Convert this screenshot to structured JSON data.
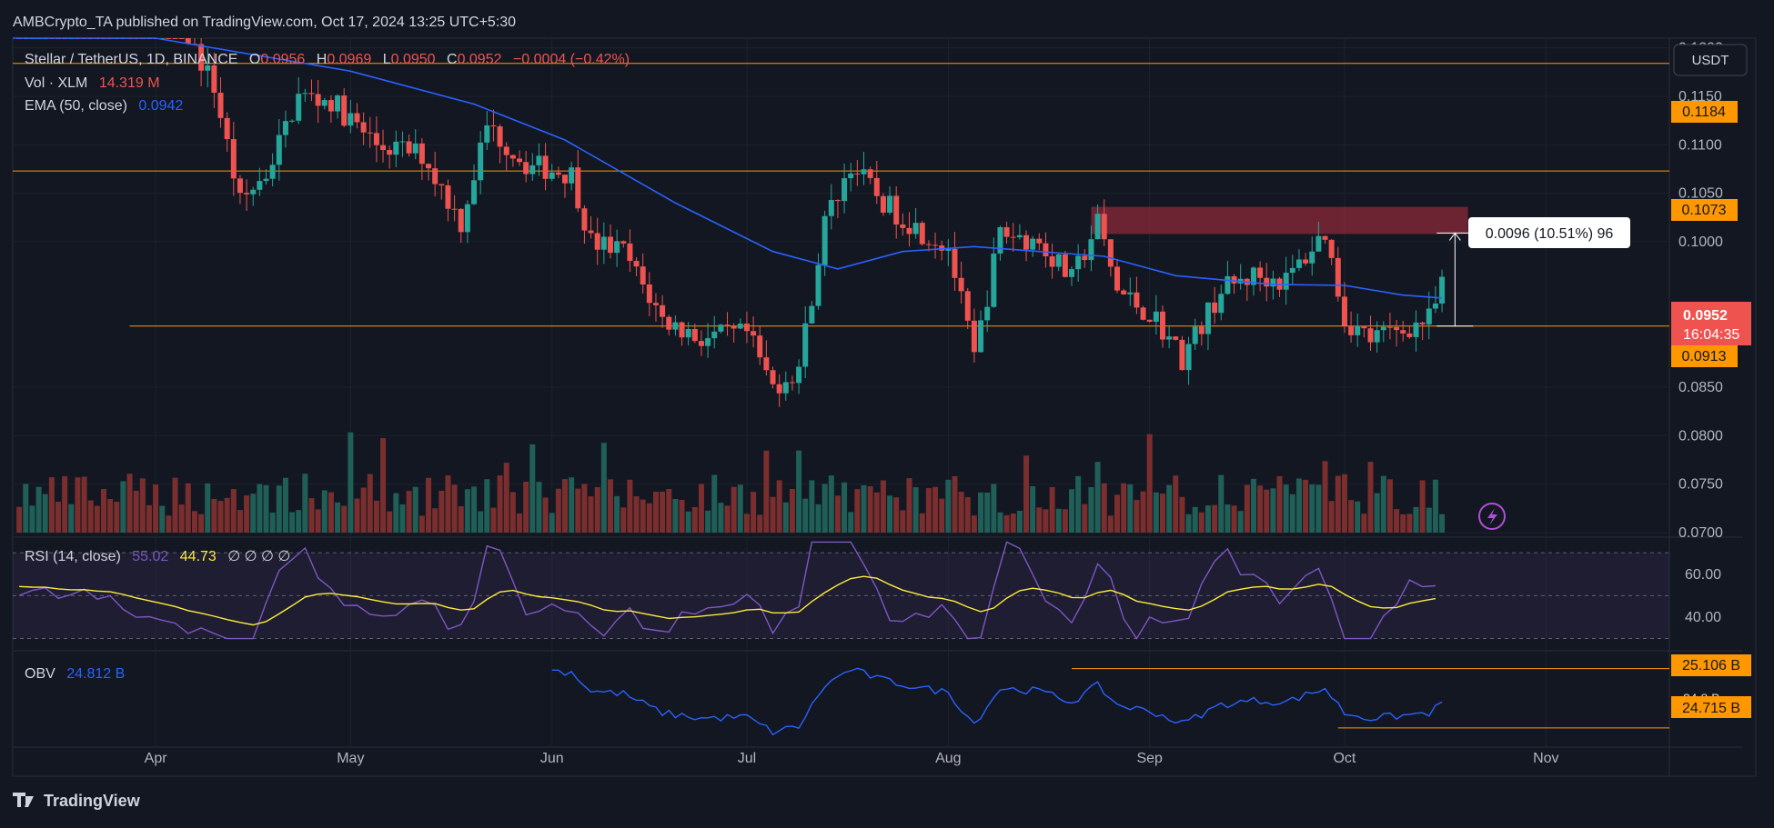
{
  "header": {
    "published_text": "AMBCrypto_TA published on TradingView.com, Oct 17, 2024 13:25 UTC+5:30",
    "currency_button": "USDT"
  },
  "legend": {
    "symbol": "Stellar / TetherUS, 1D, BINANCE",
    "o_label": "O",
    "o_value": "0.0956",
    "h_label": "H",
    "h_value": "0.0969",
    "l_label": "L",
    "l_value": "0.0950",
    "c_label": "C",
    "c_value": "0.0952",
    "change": "−0.0004 (−0.42%)",
    "vol_label": "Vol · XLM",
    "vol_value": "14.319 M",
    "ema_label": "EMA (50, close)",
    "ema_value": "0.0942",
    "rsi_label": "RSI (14, close)",
    "rsi_value": "55.02",
    "rsi_ma_value": "44.73",
    "rsi_extra": "∅ ∅ ∅ ∅",
    "obv_label": "OBV",
    "obv_value": "24.812 B"
  },
  "measure": {
    "label": "0.0096 (10.51%) 96"
  },
  "badges": {
    "r1": "0.1184",
    "r2": "0.1073",
    "s1": "0.0913",
    "last_price": "0.0952",
    "countdown": "16:04:35",
    "obv_hi": "25.106 B",
    "obv_lo": "24.715 B",
    "obv_cur": "24.8 B"
  },
  "footer": {
    "brand": "TradingView"
  },
  "colors": {
    "background": "#131722",
    "up": "#26a69a",
    "down": "#ef5350",
    "hline": "#ff9800",
    "ema": "#2962ff",
    "rsi": "#7e57c2",
    "rsi_ma": "#ffeb3b",
    "obv": "#2962ff",
    "zone": "#8b2a3a"
  },
  "chart_data": {
    "type": "candlestick",
    "timeframe": "1D",
    "x_range": [
      "2024-03-10",
      "2024-11-20"
    ],
    "x_ticks": [
      "Apr",
      "May",
      "Jun",
      "Jul",
      "Aug",
      "Sep",
      "Oct",
      "Nov"
    ],
    "y_ticks": [
      "0.1200",
      "0.1150",
      "0.1100",
      "0.1050",
      "0.1000",
      "0.0850",
      "0.0800",
      "0.0750",
      "0.0700"
    ],
    "y_range": [
      0.07,
      0.121
    ],
    "horizontal_levels": [
      0.1184,
      0.1073,
      0.0913
    ],
    "resistance_zone": {
      "from_date": "2024-08-23",
      "to_date": "2024-10-20",
      "low": 0.1008,
      "high": 0.1036
    },
    "measurement": {
      "date": "2024-10-18",
      "from": 0.0913,
      "to": 0.1009
    },
    "ema_path": [
      [
        "2024-03-10",
        0.1232
      ],
      [
        "2024-04-01",
        0.1215
      ],
      [
        "2024-05-01",
        0.1176
      ],
      [
        "2024-05-20",
        0.1142
      ],
      [
        "2024-06-03",
        0.1105
      ],
      [
        "2024-06-20",
        0.104
      ],
      [
        "2024-07-05",
        0.099
      ],
      [
        "2024-07-15",
        0.0972
      ],
      [
        "2024-07-25",
        0.099
      ],
      [
        "2024-08-05",
        0.0995
      ],
      [
        "2024-08-15",
        0.099
      ],
      [
        "2024-08-25",
        0.0985
      ],
      [
        "2024-09-05",
        0.0965
      ],
      [
        "2024-09-20",
        0.0956
      ],
      [
        "2024-10-01",
        0.0955
      ],
      [
        "2024-10-10",
        0.0945
      ],
      [
        "2024-10-16",
        0.0942
      ]
    ],
    "close_path": [
      [
        "2024-03-22",
        0.135
      ],
      [
        "2024-04-03",
        0.125
      ],
      [
        "2024-04-10",
        0.116
      ],
      [
        "2024-04-14",
        0.104
      ],
      [
        "2024-04-18",
        0.107
      ],
      [
        "2024-04-23",
        0.115
      ],
      [
        "2024-04-28",
        0.1145
      ],
      [
        "2024-05-05",
        0.11
      ],
      [
        "2024-05-12",
        0.109
      ],
      [
        "2024-05-18",
        0.102
      ],
      [
        "2024-05-22",
        0.112
      ],
      [
        "2024-05-28",
        0.108
      ],
      [
        "2024-06-04",
        0.107
      ],
      [
        "2024-06-07",
        0.1
      ],
      [
        "2024-06-12",
        0.099
      ],
      [
        "2024-06-18",
        0.092
      ],
      [
        "2024-06-24",
        0.09
      ],
      [
        "2024-07-01",
        0.0905
      ],
      [
        "2024-07-05",
        0.085
      ],
      [
        "2024-07-09",
        0.087
      ],
      [
        "2024-07-13",
        0.102
      ],
      [
        "2024-07-17",
        0.108
      ],
      [
        "2024-07-22",
        0.104
      ],
      [
        "2024-07-28",
        0.101
      ],
      [
        "2024-08-01",
        0.0995
      ],
      [
        "2024-08-05",
        0.088
      ],
      [
        "2024-08-09",
        0.101
      ],
      [
        "2024-08-15",
        0.1
      ],
      [
        "2024-08-20",
        0.096
      ],
      [
        "2024-08-24",
        0.102
      ],
      [
        "2024-08-27",
        0.095
      ],
      [
        "2024-09-02",
        0.092
      ],
      [
        "2024-09-06",
        0.088
      ],
      [
        "2024-09-12",
        0.095
      ],
      [
        "2024-09-17",
        0.0965
      ],
      [
        "2024-09-22",
        0.096
      ],
      [
        "2024-09-28",
        0.101
      ],
      [
        "2024-10-01",
        0.092
      ],
      [
        "2024-10-05",
        0.09
      ],
      [
        "2024-10-10",
        0.091
      ],
      [
        "2024-10-14",
        0.092
      ],
      [
        "2024-10-16",
        0.0952
      ]
    ],
    "volume_y_range": [
      0,
      14
    ],
    "rsi": {
      "y_ticks": [
        "60.00",
        "40.00"
      ],
      "levels": [
        70,
        50,
        30
      ],
      "y_range": [
        26,
        76
      ]
    },
    "obv": {
      "levels": [
        25.106,
        24.715
      ],
      "y_range": [
        24.6,
        25.2
      ]
    }
  }
}
